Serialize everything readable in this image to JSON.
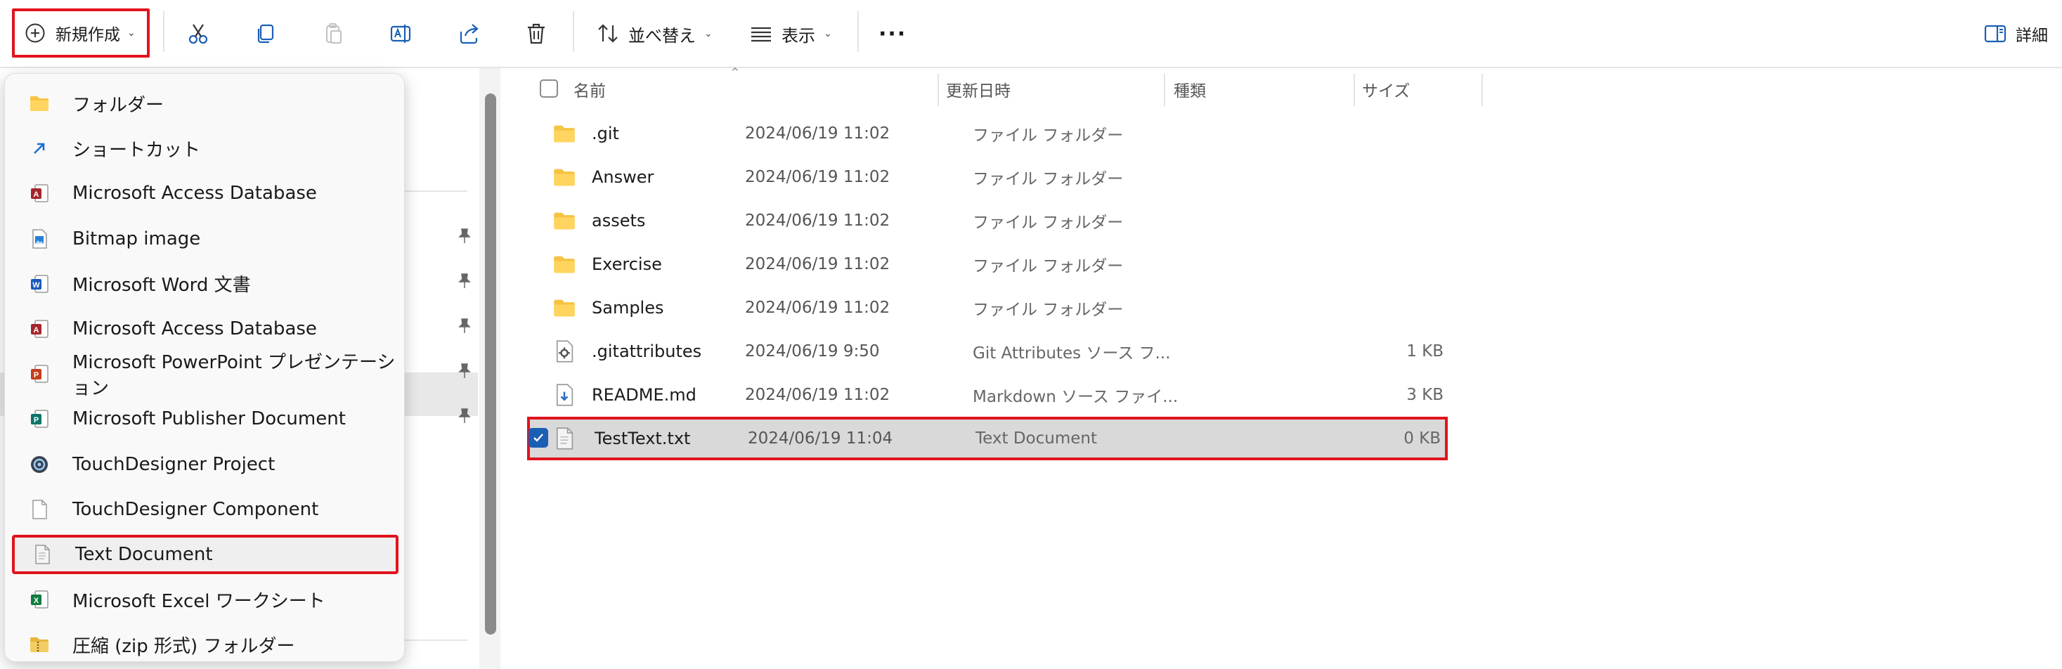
{
  "toolbar": {
    "new_label": "新規作成",
    "sort_label": "並べ替え",
    "view_label": "表示",
    "more_label": "···",
    "details_label": "詳細"
  },
  "menu": {
    "items": [
      {
        "label": "フォルダー",
        "icon": "folder-icon"
      },
      {
        "label": "ショートカット",
        "icon": "shortcut-icon"
      },
      {
        "label": "Microsoft Access Database",
        "icon": "access-icon"
      },
      {
        "label": "Bitmap image",
        "icon": "bitmap-icon"
      },
      {
        "label": "Microsoft Word 文書",
        "icon": "word-icon"
      },
      {
        "label": "Microsoft Access Database",
        "icon": "access-icon"
      },
      {
        "label": "Microsoft PowerPoint プレゼンテーション",
        "icon": "powerpoint-icon"
      },
      {
        "label": "Microsoft Publisher Document",
        "icon": "publisher-icon"
      },
      {
        "label": "TouchDesigner Project",
        "icon": "touchdesigner-icon"
      },
      {
        "label": "TouchDesigner Component",
        "icon": "blank-file-icon"
      },
      {
        "label": "Text Document",
        "icon": "text-file-icon"
      },
      {
        "label": "Microsoft Excel ワークシート",
        "icon": "excel-icon"
      },
      {
        "label": "圧縮 (zip 形式) フォルダー",
        "icon": "zip-folder-icon"
      }
    ],
    "highlighted_index": 10
  },
  "columns": {
    "name": "名前",
    "modified": "更新日時",
    "type": "種類",
    "size": "サイズ"
  },
  "files": [
    {
      "name": ".git",
      "modified": "2024/06/19 11:02",
      "type": "ファイル フォルダー",
      "size": "",
      "icon": "folder-icon"
    },
    {
      "name": "Answer",
      "modified": "2024/06/19 11:02",
      "type": "ファイル フォルダー",
      "size": "",
      "icon": "folder-icon"
    },
    {
      "name": "assets",
      "modified": "2024/06/19 11:02",
      "type": "ファイル フォルダー",
      "size": "",
      "icon": "folder-icon"
    },
    {
      "name": "Exercise",
      "modified": "2024/06/19 11:02",
      "type": "ファイル フォルダー",
      "size": "",
      "icon": "folder-icon"
    },
    {
      "name": "Samples",
      "modified": "2024/06/19 11:02",
      "type": "ファイル フォルダー",
      "size": "",
      "icon": "folder-icon"
    },
    {
      "name": ".gitattributes",
      "modified": "2024/06/19 9:50",
      "type": "Git Attributes ソース フ...",
      "size": "1 KB",
      "icon": "gear-file-icon"
    },
    {
      "name": "README.md",
      "modified": "2024/06/19 11:02",
      "type": "Markdown ソース ファイ...",
      "size": "3 KB",
      "icon": "markdown-file-icon"
    },
    {
      "name": "TestText.txt",
      "modified": "2024/06/19 11:04",
      "type": "Text Document",
      "size": "0 KB",
      "icon": "text-file-icon",
      "selected": true
    }
  ],
  "colors": {
    "highlight_border": "#e0141e",
    "selected_row": "#d9d9d9",
    "checkbox_blue": "#1a5fb4",
    "folder_yellow": "#f6c342"
  }
}
